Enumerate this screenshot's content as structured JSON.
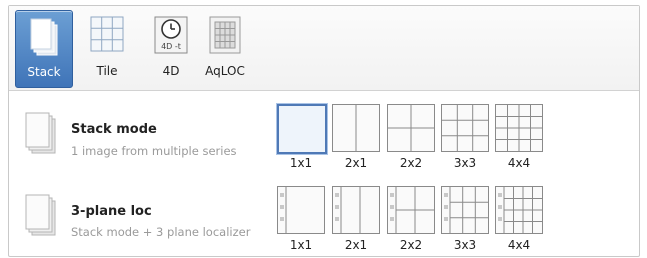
{
  "toolbar": {
    "buttons": [
      {
        "label": "Stack",
        "icon": "stack-icon",
        "active": true
      },
      {
        "label": "Tile",
        "icon": "tile-grid-icon",
        "active": false
      },
      {
        "label": "4D",
        "icon": "clock-4d-icon",
        "icon_text": "4D -t",
        "active": false
      },
      {
        "label": "AqLOC",
        "icon": "aqloc-grid-icon",
        "active": false
      }
    ]
  },
  "modes": [
    {
      "title": "Stack mode",
      "description": "1 image from multiple series",
      "icon": "stack-pages-icon",
      "layouts": [
        {
          "label": "1x1",
          "selected": true
        },
        {
          "label": "2x1",
          "selected": false
        },
        {
          "label": "2x2",
          "selected": false
        },
        {
          "label": "3x3",
          "selected": false
        },
        {
          "label": "4x4",
          "selected": false
        }
      ]
    },
    {
      "title": "3-plane loc",
      "description": "Stack mode + 3 plane localizer",
      "icon": "stack-pages-icon",
      "layouts": [
        {
          "label": "1x1",
          "selected": false
        },
        {
          "label": "2x1",
          "selected": false
        },
        {
          "label": "2x2",
          "selected": false
        },
        {
          "label": "3x3",
          "selected": false
        },
        {
          "label": "4x4",
          "selected": false
        }
      ]
    }
  ],
  "colors": {
    "accent": "#3f74b8",
    "selection": "#4f79b6",
    "muted_text": "#9a9a9a"
  }
}
